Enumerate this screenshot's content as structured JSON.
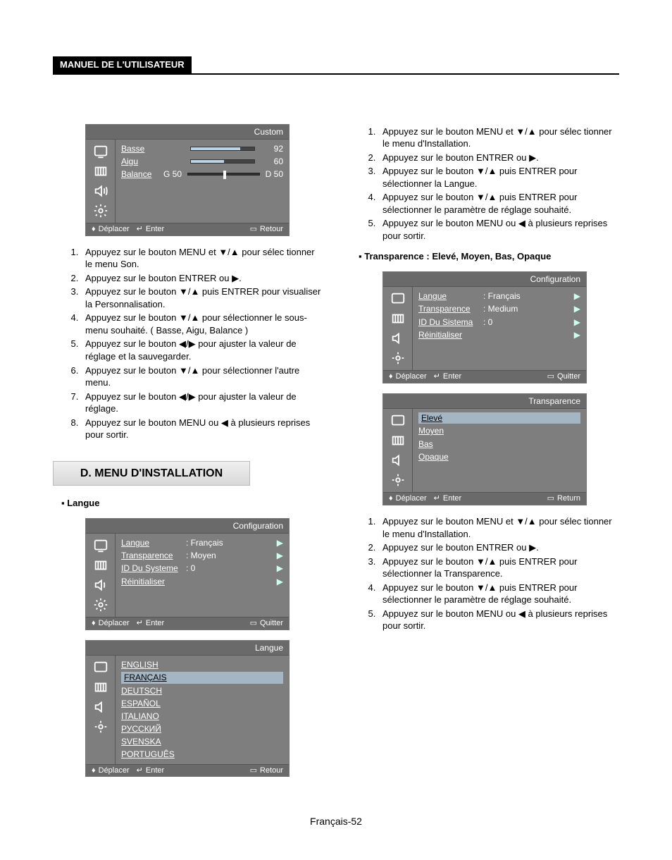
{
  "header": "MANUEL DE L'UTILISATEUR",
  "page_foot": "Français-52",
  "arrows": {
    "up": "▲",
    "down": "▼",
    "left": "◀",
    "right": "▶",
    "enter": "↵"
  },
  "osd_sound": {
    "title": "Custom",
    "rows": [
      {
        "label": "Basse",
        "value": 92,
        "fill": 78
      },
      {
        "label": "Aigu",
        "value": 60,
        "fill": 52
      },
      {
        "label": "Balance",
        "left": "G 50",
        "right": "D 50"
      }
    ],
    "foot": {
      "move": "Déplacer",
      "enter": "Enter",
      "exit": "Retour"
    }
  },
  "steps_sound": [
    "Appuyez sur le bouton MENU et ▼/▲ pour sélec tionner le menu Son.",
    "Appuyez sur le bouton ENTRER ou ▶.",
    "Appuyez sur le bouton ▼/▲ puis ENTRER pour visualiser la Personnalisation.",
    "Appuyez sur le bouton ▼/▲ pour sélectionner le  sous-menu souhaité. ( Basse, Aigu, Balance )",
    "Appuyez sur le bouton ◀/▶ pour ajuster la valeur de réglage et la sauvegarder.",
    "Appuyez sur le bouton ▼/▲ pour sélectionner l'autre menu.",
    "Appuyez sur le bouton ◀/▶ pour ajuster la valeur de réglage.",
    "Appuyez sur le bouton MENU ou ◀ à plusieurs reprises pour sortir."
  ],
  "section_d": "D. MENU D'INSTALLATION",
  "sub_langue": "Langue",
  "osd_config": {
    "title": "Configuration",
    "rows": [
      {
        "label": "Langue",
        "value": ": Français"
      },
      {
        "label": "Transparence",
        "value": ": Moyen"
      },
      {
        "label": "ID Du Systeme",
        "value": ": 0"
      },
      {
        "label": "Réinitialiser",
        "value": ""
      }
    ],
    "foot": {
      "move": "Déplacer",
      "enter": "Enter",
      "exit": "Quitter"
    }
  },
  "osd_lang": {
    "title": "Langue",
    "items": [
      "ENGLISH",
      "FRANÇAIS",
      "DEUTSCH",
      "ESPAÑOL",
      "ITALIANO",
      "РУССКИЙ",
      "SVENSKA",
      "PORTUGUÊS"
    ],
    "selected": 1,
    "foot": {
      "move": "Déplacer",
      "enter": "Enter",
      "exit": "Retour"
    }
  },
  "steps_install": [
    "Appuyez sur le bouton MENU et  ▼/▲  pour sélec tionner le menu d'Installation.",
    "Appuyez sur le bouton ENTRER ou ▶.",
    "Appuyez sur le bouton  ▼/▲  puis ENTRER pour sélectionner la Langue.",
    "Appuyez sur le bouton  ▼/▲  puis ENTRER pour sélectionner le paramètre de réglage souhaité.",
    "Appuyez sur le bouton MENU ou ◀ à plusieurs reprises pour sortir."
  ],
  "sub_transparence": "Transparence : Elevé, Moyen, Bas, Opaque",
  "osd_config2": {
    "title": "Configuration",
    "rows": [
      {
        "label": "Langue",
        "value": ": Français"
      },
      {
        "label": "Transparence",
        "value": ": Medium"
      },
      {
        "label": "ID Du Sistema",
        "value": ": 0"
      },
      {
        "label": "Réinitialiser",
        "value": ""
      }
    ],
    "foot": {
      "move": "Déplacer",
      "enter": "Enter",
      "exit": "Quitter"
    }
  },
  "osd_trans": {
    "title": "Transparence",
    "items": [
      "Elevé",
      "Moyen",
      "Bas",
      "Opaque"
    ],
    "selected": 0,
    "foot": {
      "move": "Déplacer",
      "enter": "Enter",
      "exit": "Return"
    }
  },
  "steps_trans": [
    "Appuyez sur le bouton MENU et ▼/▲ pour sélec tionner le menu d'Installation.",
    "Appuyez sur le bouton ENTRER ou ▶.",
    "Appuyez sur le bouton ▼/▲ puis ENTRER pour sélectionner la Transparence.",
    "Appuyez sur le bouton ▼/▲ puis ENTRER pour sélectionner le paramètre de réglage souhaité.",
    "Appuyez sur le bouton MENU ou ◀ à plusieurs reprises pour sortir."
  ]
}
